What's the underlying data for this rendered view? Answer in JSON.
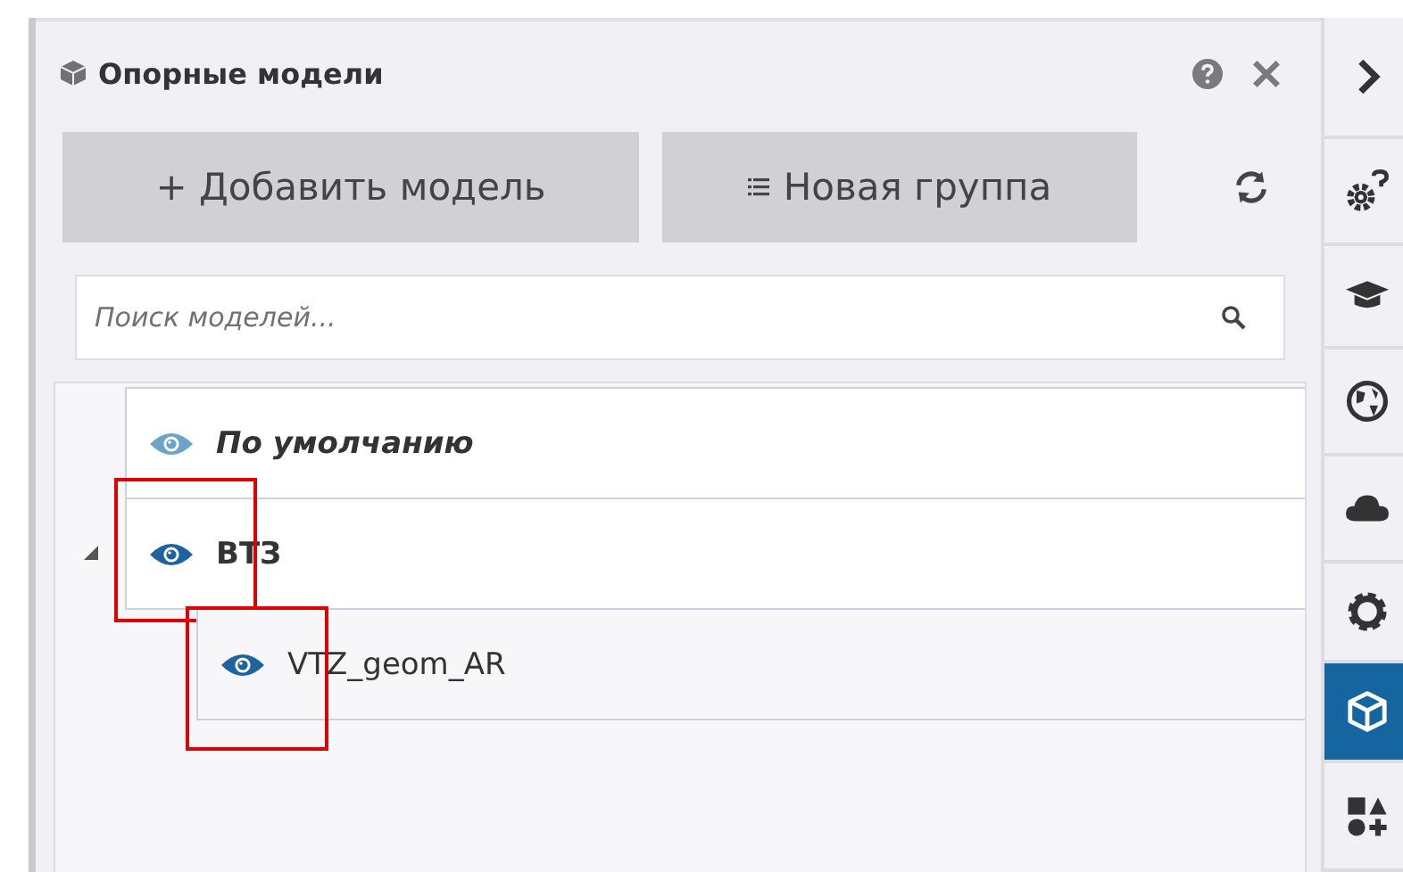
{
  "panel": {
    "title": "Опорные модели"
  },
  "toolbar": {
    "add_button": "+ Добавить модель",
    "group_button": "Новая группа"
  },
  "search": {
    "placeholder": "Поиск моделей..."
  },
  "tree": [
    {
      "kind": "default",
      "label": "По умолчанию",
      "highlighted": false
    },
    {
      "kind": "group",
      "label": "ВТЗ",
      "expanded": true,
      "highlighted": true,
      "children": [
        {
          "kind": "model",
          "label": "VTZ_geom_AR",
          "highlighted": true
        }
      ]
    }
  ],
  "sidebar": {
    "items": [
      {
        "kind": "chevron",
        "selected": false
      },
      {
        "kind": "gear-question",
        "selected": false
      },
      {
        "kind": "cap",
        "selected": false
      },
      {
        "kind": "globe",
        "selected": false
      },
      {
        "kind": "cloud",
        "selected": false
      },
      {
        "kind": "gear",
        "selected": false
      },
      {
        "kind": "cube",
        "selected": true
      },
      {
        "kind": "shapes",
        "selected": false
      }
    ]
  }
}
